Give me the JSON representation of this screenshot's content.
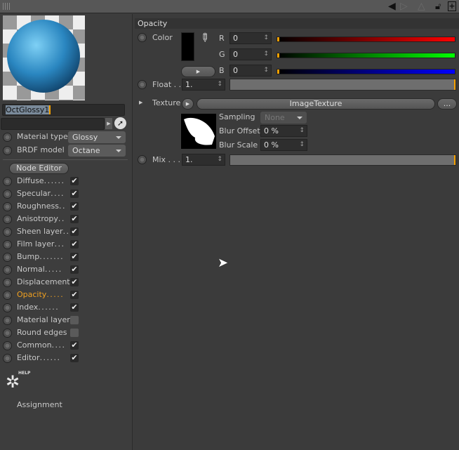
{
  "toolbar": {
    "icons": [
      "grip-icon",
      "back-arrow-icon",
      "forward-arrow-icon",
      "up-arrow-icon",
      "unlock-icon",
      "new-panel-icon"
    ]
  },
  "material": {
    "name": "OctGlossy1",
    "link_value": ""
  },
  "settings": {
    "material_type_label": "Material type",
    "material_type_value": "Glossy",
    "brdf_label": "BRDF model",
    "brdf_value": "Octane",
    "node_editor": "Node Editor"
  },
  "channels": [
    {
      "label": "Diffuse",
      "dots": ". . . . . .",
      "checked": true
    },
    {
      "label": "Specular",
      "dots": ". . . .",
      "checked": true
    },
    {
      "label": "Roughness",
      "dots": ". .",
      "checked": true
    },
    {
      "label": "Anisotropy",
      "dots": ". .",
      "checked": true
    },
    {
      "label": "Sheen layer",
      "dots": ". .",
      "checked": true
    },
    {
      "label": "Film layer",
      "dots": ". . .",
      "checked": true
    },
    {
      "label": "Bump",
      "dots": ". . . . . . .",
      "checked": true
    },
    {
      "label": "Normal",
      "dots": ". . . . .",
      "checked": true
    },
    {
      "label": "Displacement",
      "dots": "",
      "checked": true
    },
    {
      "label": "Opacity",
      "dots": ". . . . .",
      "checked": true,
      "active": true
    },
    {
      "label": "Index",
      "dots": ". . . . . .",
      "checked": true
    },
    {
      "label": "Material layer",
      "dots": "",
      "checked": false
    },
    {
      "label": "Round edges",
      "dots": "",
      "checked": false
    },
    {
      "label": "Common",
      "dots": ". . . .",
      "checked": true
    },
    {
      "label": "Editor",
      "dots": ". . . . . .",
      "checked": true
    }
  ],
  "help": {
    "label": "HELP",
    "assignment": "Assignment"
  },
  "opacity": {
    "title": "Opacity",
    "color_label": "Color",
    "swatch": "#000000",
    "r_label": "R",
    "r": "0",
    "g_label": "G",
    "g": "0",
    "b_label": "B",
    "b": "0",
    "float_label": "Float . .",
    "float": "1.",
    "float_fraction": 1,
    "texture_label": "Texture",
    "texture_value": "ImageTexture",
    "more": "...",
    "sampling_label": "Sampling",
    "sampling": "None",
    "blur_offset_label": "Blur Offset",
    "blur_offset": "0 %",
    "blur_scale_label": "Blur Scale",
    "blur_scale": "0 %",
    "mix_label": "Mix . . .",
    "mix": "1.",
    "mix_fraction": 1
  },
  "colors": {
    "accent": "#f4a000",
    "active_channel": "#f0a020"
  }
}
